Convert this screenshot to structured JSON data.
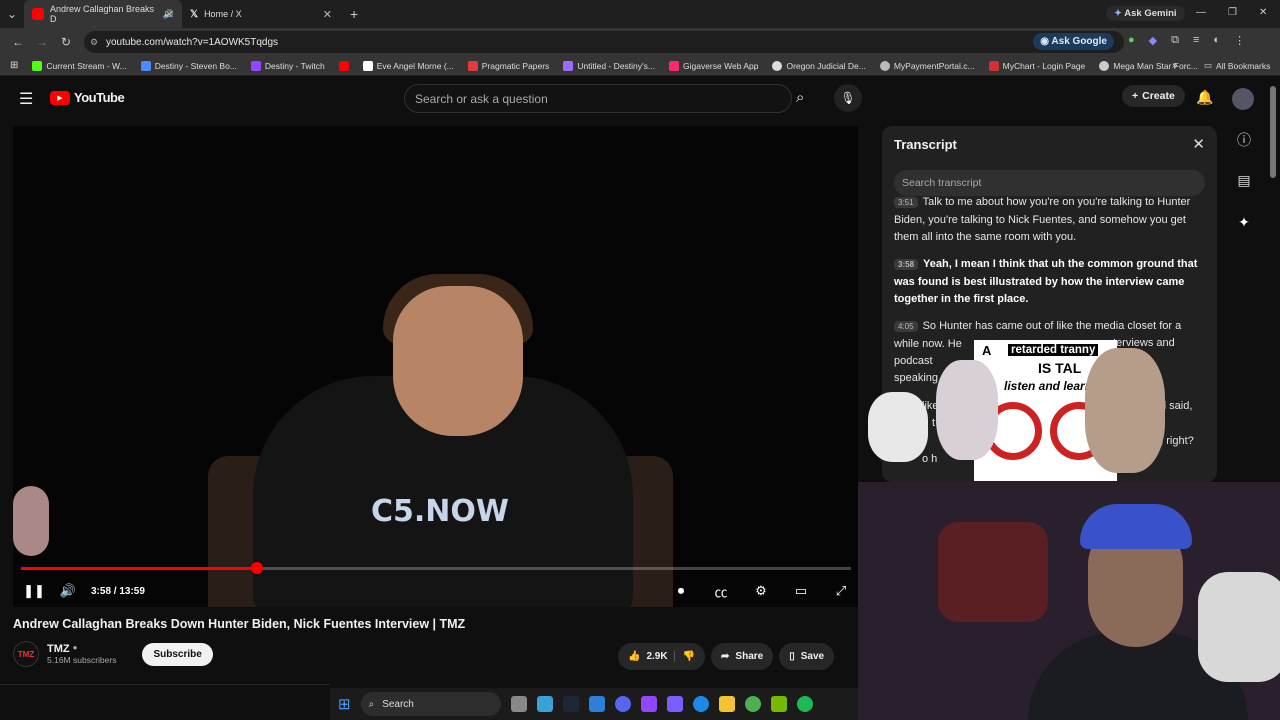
{
  "browser": {
    "tabs": [
      {
        "title": "Andrew Callaghan Breaks D",
        "active": true
      },
      {
        "title": "Home / X",
        "active": false
      }
    ],
    "url": "youtube.com/watch?v=1AOWK5Tqdgs",
    "tab_close": "✕",
    "new_tab": "+",
    "ask_gemini": "Ask Gemini",
    "ask_google": "Ask Google",
    "all_bookmarks": "All Bookmarks",
    "bookmarks": [
      {
        "label": "Current Stream - W...",
        "color": "#53fc18"
      },
      {
        "label": "Destiny - Steven Bo...",
        "color": "#4a8cff"
      },
      {
        "label": "Destiny - Twitch",
        "color": "#9146ff"
      },
      {
        "label": "",
        "color": "#ff0000"
      },
      {
        "label": "Eve Angel Morne (...",
        "color": "#ffffff"
      },
      {
        "label": "Pragmatic Papers",
        "color": "#e23b3b"
      },
      {
        "label": "Untitled - Destiny's...",
        "color": "#9c6bff"
      },
      {
        "label": "Gigaverse Web App",
        "color": "#ff2a6d"
      },
      {
        "label": "Oregon Judicial De...",
        "color": "#dddddd"
      },
      {
        "label": "MyPaymentPortal.c...",
        "color": "#bbbbbb"
      },
      {
        "label": "MyChart - Login Page",
        "color": "#d03030"
      },
      {
        "label": "Mega Man Star Forc...",
        "color": "#cccccc"
      }
    ]
  },
  "youtube": {
    "logo": "YouTube",
    "search_placeholder": "Search or ask a question",
    "create_label": "Create"
  },
  "player": {
    "current_time": "3:58",
    "duration": "13:59",
    "time_display": "3:58 / 13:59",
    "progress_fraction": 0.2843,
    "shirt_logo": "C5.NOW"
  },
  "video": {
    "title": "Andrew Callaghan Breaks Down Hunter Biden, Nick Fuentes Interview | TMZ",
    "channel": "TMZ",
    "subscribers": "5.16M subscribers",
    "subscribe_label": "Subscribe",
    "likes": "2.9K",
    "share_label": "Share",
    "save_label": "Save"
  },
  "transcript": {
    "title": "Transcript",
    "search_placeholder": "Search transcript",
    "segments": [
      {
        "time": "3:51",
        "text": "Talk to me about how you're on you're talking to Hunter Biden, you're talking to Nick Fuentes, and somehow you get them all into the same room with you.",
        "current": false
      },
      {
        "time": "3:58",
        "text": "Yeah, I mean I think that uh the common ground that was found is best illustrated by how the interview came together in the first place.",
        "current": true
      },
      {
        "time": "4:05",
        "text": "So Hunter has came out of like the media closet for a while now. He",
        "current": false
      }
    ],
    "partial_lines": [
      "terviews and",
      "podcast",
      "speaking",
      "like",
      "d said,",
      "t t",
      "e, right?",
      "o h"
    ]
  },
  "overlay_sticker": {
    "a": "A",
    "line1": "retarded tranny",
    "line2": "IS TAL",
    "line3": "listen and learn"
  },
  "taskbar": {
    "search_label": "Search"
  }
}
